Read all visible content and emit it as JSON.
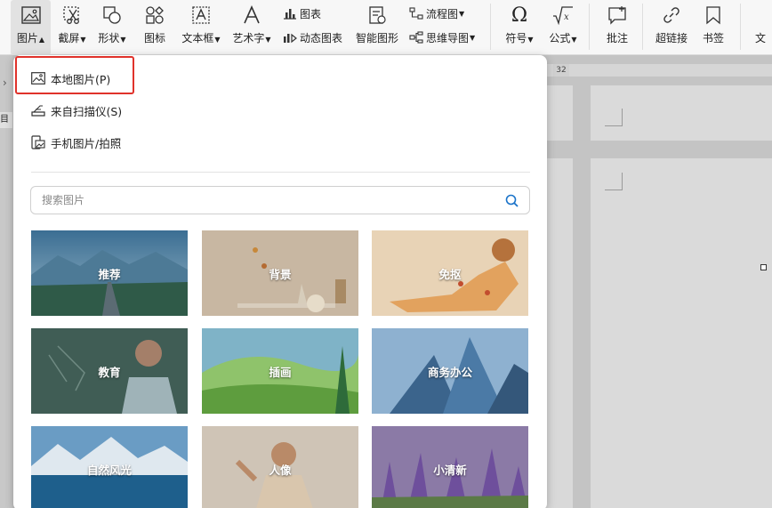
{
  "ribbon": {
    "picture": "图片",
    "screenshot": "截屏",
    "shape": "形状",
    "icon": "图标",
    "textbox": "文本框",
    "wordart": "艺术字",
    "chart": "图表",
    "dynamic_chart": "动态图表",
    "smart_graphic": "智能图形",
    "flowchart": "流程图",
    "mindmap": "思维导图",
    "symbol": "符号",
    "formula": "公式",
    "comment": "批注",
    "hyperlink": "超链接",
    "bookmark": "书签",
    "text_more": "文"
  },
  "left": {
    "tab_label": "目录"
  },
  "ruler": {
    "number": "32"
  },
  "menu": {
    "local_picture": "本地图片(P)",
    "from_scanner": "来自扫描仪(S)",
    "phone_picture": "手机图片/拍照"
  },
  "search": {
    "placeholder": "搜索图片"
  },
  "categories": [
    "推荐",
    "背景",
    "免抠",
    "教育",
    "插画",
    "商务办公",
    "自然风光",
    "人像",
    "小清新"
  ],
  "colors": {
    "highlight": "#e0322b",
    "accent": "#1a73c9"
  }
}
